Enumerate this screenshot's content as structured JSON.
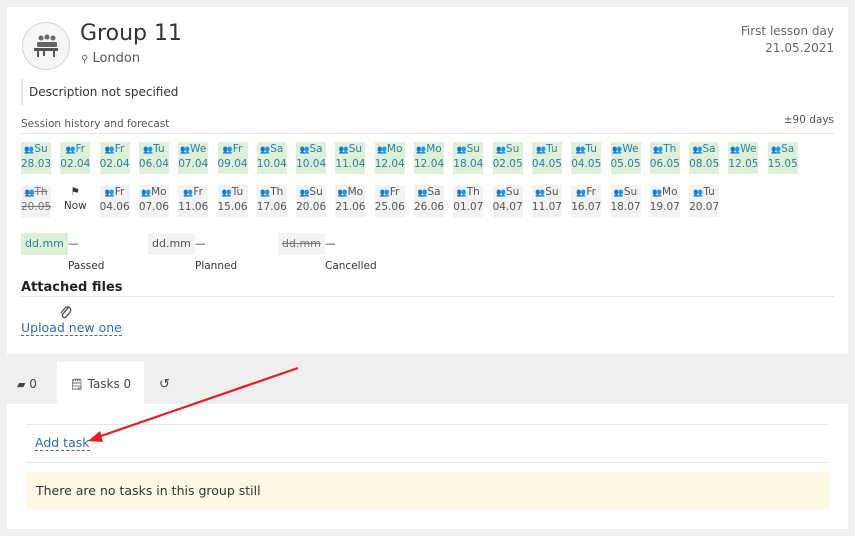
{
  "group": {
    "title": "Group 11",
    "city": "London",
    "first_lesson_label": "First lesson day",
    "first_lesson_date": "21.05.2021",
    "description": "Description not specified"
  },
  "session_history": {
    "label": "Session history and forecast",
    "range": "±90 days",
    "now_label": "Now",
    "row1": [
      {
        "day": "Su",
        "date": "28.03",
        "status": "passed"
      },
      {
        "day": "Fr",
        "date": "02.04",
        "status": "passed"
      },
      {
        "day": "Fr",
        "date": "02.04",
        "status": "passed"
      },
      {
        "day": "Tu",
        "date": "06.04",
        "status": "passed"
      },
      {
        "day": "We",
        "date": "07.04",
        "status": "passed"
      },
      {
        "day": "Fr",
        "date": "09.04",
        "status": "passed"
      },
      {
        "day": "Sa",
        "date": "10.04",
        "status": "passed"
      },
      {
        "day": "Sa",
        "date": "10.04",
        "status": "passed"
      },
      {
        "day": "Su",
        "date": "11.04",
        "status": "passed"
      },
      {
        "day": "Mo",
        "date": "12.04",
        "status": "passed"
      },
      {
        "day": "Mo",
        "date": "12.04",
        "status": "passed"
      },
      {
        "day": "Su",
        "date": "18.04",
        "status": "passed"
      },
      {
        "day": "Su",
        "date": "02.05",
        "status": "passed"
      },
      {
        "day": "Tu",
        "date": "04.05",
        "status": "passed"
      },
      {
        "day": "Tu",
        "date": "04.05",
        "status": "passed"
      },
      {
        "day": "We",
        "date": "05.05",
        "status": "passed"
      },
      {
        "day": "Th",
        "date": "06.05",
        "status": "passed"
      },
      {
        "day": "Sa",
        "date": "08.05",
        "status": "passed"
      },
      {
        "day": "We",
        "date": "12.05",
        "status": "passed"
      },
      {
        "day": "Sa",
        "date": "15.05",
        "status": "passed"
      }
    ],
    "row2": [
      {
        "day": "Th",
        "date": "20.05",
        "status": "cancelled"
      },
      {
        "day": "",
        "date": "Now",
        "status": "now"
      },
      {
        "day": "Fr",
        "date": "04.06",
        "status": "planned"
      },
      {
        "day": "Mo",
        "date": "07.06",
        "status": "planned"
      },
      {
        "day": "Fr",
        "date": "11.06",
        "status": "planned"
      },
      {
        "day": "Tu",
        "date": "15.06",
        "status": "planned"
      },
      {
        "day": "Th",
        "date": "17.06",
        "status": "planned"
      },
      {
        "day": "Su",
        "date": "20.06",
        "status": "planned"
      },
      {
        "day": "Mo",
        "date": "21.06",
        "status": "planned"
      },
      {
        "day": "Fr",
        "date": "25.06",
        "status": "planned"
      },
      {
        "day": "Sa",
        "date": "26.06",
        "status": "planned"
      },
      {
        "day": "Th",
        "date": "01.07",
        "status": "planned"
      },
      {
        "day": "Su",
        "date": "04.07",
        "status": "planned"
      },
      {
        "day": "Su",
        "date": "11.07",
        "status": "planned"
      },
      {
        "day": "Fr",
        "date": "16.07",
        "status": "planned"
      },
      {
        "day": "Su",
        "date": "18.07",
        "status": "planned"
      },
      {
        "day": "Mo",
        "date": "19.07",
        "status": "planned"
      },
      {
        "day": "Tu",
        "date": "20.07",
        "status": "planned"
      }
    ]
  },
  "legend": {
    "passed_box": "dd.mm",
    "passed_text": "— Passed",
    "planned_box": "dd.mm",
    "planned_text": "— Planned",
    "cancelled_box": "dd.mm",
    "cancelled_text": "— Cancelled"
  },
  "attached_files": {
    "title": "Attached files",
    "upload_label": "Upload new one"
  },
  "tabs": {
    "comments_count": "0",
    "tasks_label": "Tasks 0"
  },
  "tasks": {
    "add_label": "Add task",
    "empty_notice": "There are no tasks in this group still"
  },
  "colors": {
    "passed_bg": "#dff0d8",
    "link": "#2a6fa8",
    "notice_bg": "#fcf8e3",
    "arrow": "#e02020"
  }
}
